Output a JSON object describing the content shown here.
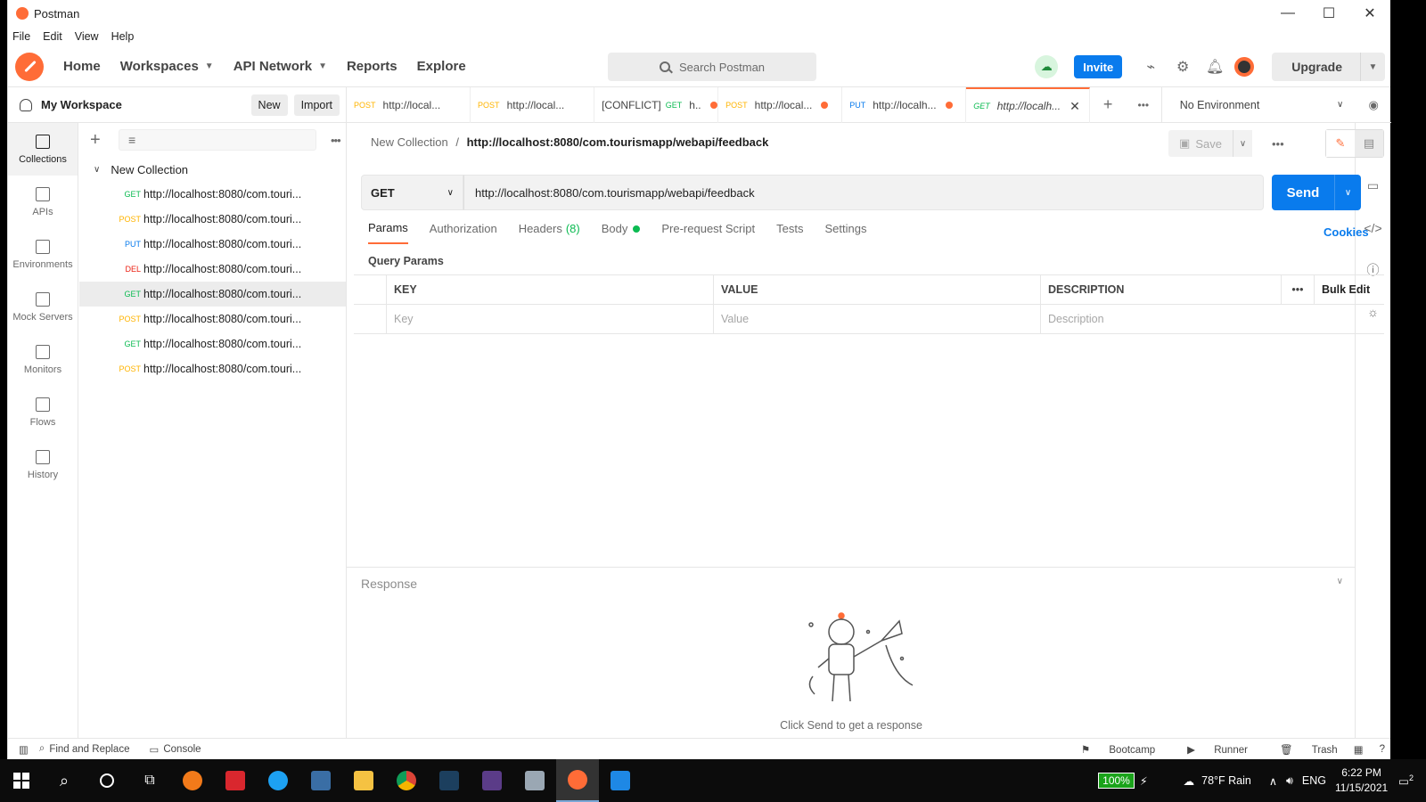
{
  "window": {
    "title": "Postman",
    "minimize": "—",
    "maximize": "☐",
    "close": "✕"
  },
  "menu": [
    "File",
    "Edit",
    "View",
    "Help"
  ],
  "nav": {
    "home": "Home",
    "workspaces": "Workspaces",
    "api_network": "API Network",
    "reports": "Reports",
    "explore": "Explore"
  },
  "search": {
    "placeholder": "Search Postman"
  },
  "header": {
    "invite": "Invite",
    "upgrade": "Upgrade"
  },
  "workspace": {
    "name": "My Workspace",
    "new_label": "New",
    "import_label": "Import"
  },
  "rail": [
    {
      "label": "Collections"
    },
    {
      "label": "APIs"
    },
    {
      "label": "Environments"
    },
    {
      "label": "Mock Servers"
    },
    {
      "label": "Monitors"
    },
    {
      "label": "Flows"
    },
    {
      "label": "History"
    }
  ],
  "collection": {
    "name": "New Collection",
    "requests": [
      {
        "method": "GET",
        "url": "http://localhost:8080/com.touri..."
      },
      {
        "method": "POST",
        "url": "http://localhost:8080/com.touri..."
      },
      {
        "method": "PUT",
        "url": "http://localhost:8080/com.touri..."
      },
      {
        "method": "DEL",
        "url": "http://localhost:8080/com.touri..."
      },
      {
        "method": "GET",
        "url": "http://localhost:8080/com.touri..."
      },
      {
        "method": "POST",
        "url": "http://localhost:8080/com.touri..."
      },
      {
        "method": "GET",
        "url": "http://localhost:8080/com.touri..."
      },
      {
        "method": "POST",
        "url": "http://localhost:8080/com.touri..."
      }
    ]
  },
  "tabs": [
    {
      "prefix": "",
      "method": "POST",
      "label": "http://local..."
    },
    {
      "prefix": "",
      "method": "POST",
      "label": "http://local..."
    },
    {
      "prefix": "[CONFLICT]",
      "method": "GET",
      "label": "h.."
    },
    {
      "prefix": "",
      "method": "POST",
      "label": "http://local..."
    },
    {
      "prefix": "",
      "method": "PUT",
      "label": "http://localh..."
    },
    {
      "prefix": "",
      "method": "GET",
      "label": "http://localh..."
    }
  ],
  "environment": {
    "selected": "No Environment"
  },
  "request": {
    "breadcrumb_parent": "New Collection",
    "breadcrumb_sep": "/",
    "breadcrumb_current": "http://localhost:8080/com.tourismapp/webapi/feedback",
    "save_label": "Save",
    "method": "GET",
    "url": "http://localhost:8080/com.tourismapp/webapi/feedback",
    "send_label": "Send",
    "tabs": {
      "params": "Params",
      "authorization": "Authorization",
      "headers": "Headers",
      "headers_count": "(8)",
      "body": "Body",
      "prerequest": "Pre-request Script",
      "tests": "Tests",
      "settings": "Settings"
    },
    "cookies": "Cookies",
    "query_params_title": "Query Params",
    "table": {
      "key": "KEY",
      "value": "VALUE",
      "description": "DESCRIPTION",
      "bulk_edit": "Bulk Edit",
      "key_placeholder": "Key",
      "value_placeholder": "Value",
      "description_placeholder": "Description"
    }
  },
  "response": {
    "label": "Response",
    "hint": "Click Send to get a response"
  },
  "statusbar": {
    "find_replace": "Find and Replace",
    "console": "Console",
    "bootcamp": "Bootcamp",
    "runner": "Runner",
    "trash": "Trash"
  },
  "taskbar": {
    "battery": "100%",
    "weather": "78°F  Rain",
    "lang": "ENG",
    "time": "6:22 PM",
    "date": "11/15/2021",
    "notifications": "2"
  },
  "colors": {
    "accent": "#ff6c37",
    "primary": "#097bed",
    "get": "#0cbb52",
    "post": "#ffb400",
    "put": "#097bed",
    "del": "#eb2013"
  }
}
